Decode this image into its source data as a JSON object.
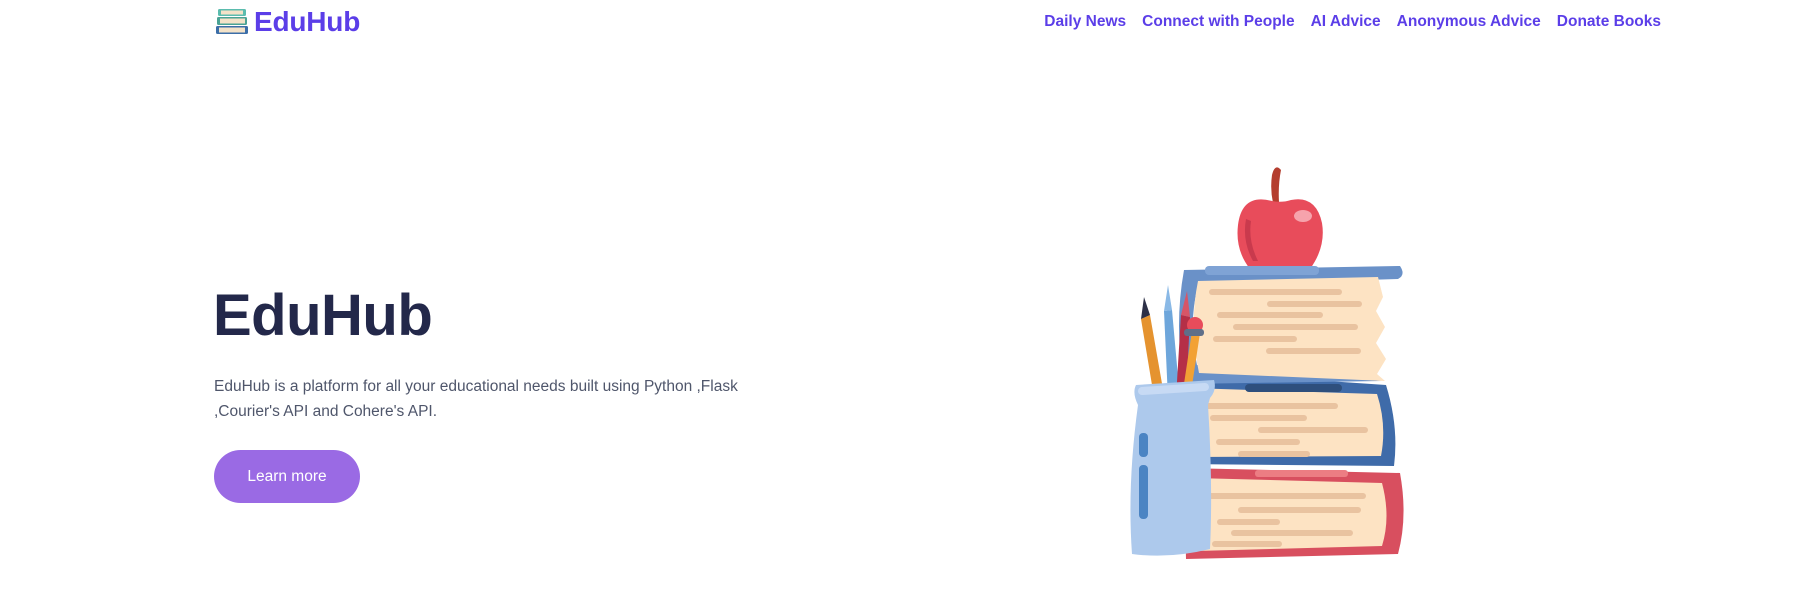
{
  "header": {
    "brand_name": "EduHub",
    "brand_icon": "books-stack-icon",
    "nav_items": [
      {
        "label": "Daily News"
      },
      {
        "label": "Connect with People"
      },
      {
        "label": "AI Advice"
      },
      {
        "label": "Anonymous Advice"
      },
      {
        "label": "Donate Books"
      }
    ]
  },
  "hero": {
    "title": "EduHub",
    "description": "EduHub is a platform for all your educational needs built using Python ,Flask ,Courier's API and Cohere's API.",
    "cta_label": "Learn more",
    "illustration": "books-apple-pencils-illustration"
  },
  "colors": {
    "brand": "#5b3ee8",
    "title": "#23284a",
    "text": "#4f566b",
    "button": "#9a6ae4",
    "background": "#ffffff"
  }
}
